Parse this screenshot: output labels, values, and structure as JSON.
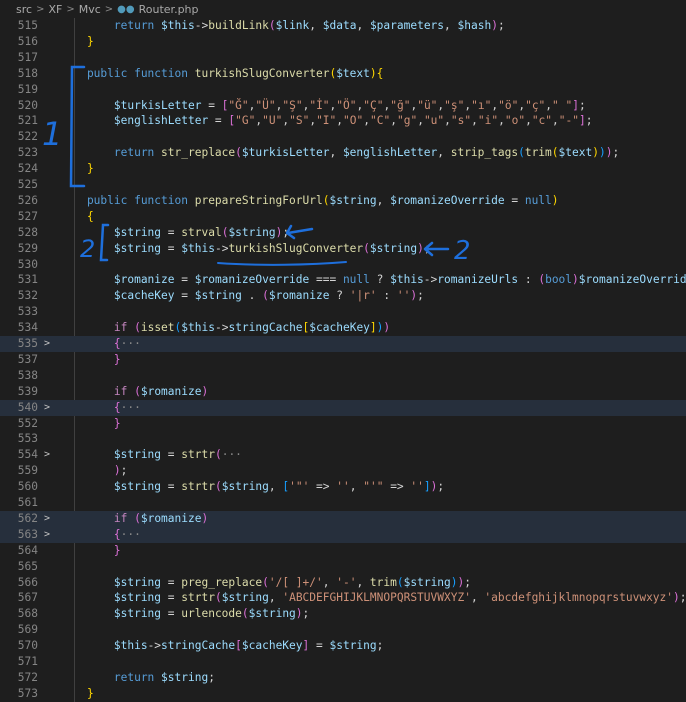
{
  "breadcrumb": {
    "items": [
      "src",
      "XF",
      "Mvc",
      "Router.php"
    ]
  },
  "colors": {
    "background": "#1e1e1e",
    "line_number": "#858585",
    "keyword": "#569cd6",
    "control": "#c586c0",
    "function": "#dcdcaa",
    "variable": "#9cdcfe",
    "string": "#ce9178",
    "annotation_pen": "#1e6fdc",
    "folded_line_highlight": "#262f3c"
  },
  "annotations": {
    "mark_1": "1",
    "mark_2a": "2",
    "mark_2b": "2"
  },
  "lines": [
    {
      "n": "515",
      "tokens": [
        [
          "kw",
          "        return "
        ],
        [
          "var",
          "$this"
        ],
        [
          "pl",
          "->"
        ],
        [
          "fn",
          "buildLink"
        ],
        [
          "br1",
          "("
        ],
        [
          "var",
          "$link"
        ],
        [
          "pl",
          ", "
        ],
        [
          "var",
          "$data"
        ],
        [
          "pl",
          ", "
        ],
        [
          "var",
          "$parameters"
        ],
        [
          "pl",
          ", "
        ],
        [
          "var",
          "$hash"
        ],
        [
          "br1",
          ")"
        ],
        [
          "pl",
          ";"
        ]
      ]
    },
    {
      "n": "516",
      "tokens": [
        [
          "br2",
          "    }"
        ]
      ]
    },
    {
      "n": "517",
      "tokens": []
    },
    {
      "n": "518",
      "tokens": [
        [
          "kw",
          "    public function "
        ],
        [
          "fn",
          "turkishSlugConverter"
        ],
        [
          "br2",
          "("
        ],
        [
          "var",
          "$text"
        ],
        [
          "br2",
          ")"
        ],
        [
          "br2",
          "{"
        ]
      ]
    },
    {
      "n": "519",
      "tokens": []
    },
    {
      "n": "520",
      "tokens": [
        [
          "var",
          "        $turkisLetter"
        ],
        [
          "pl",
          " = "
        ],
        [
          "br1",
          "["
        ],
        [
          "str",
          "\"Ğ\""
        ],
        [
          "pl",
          ","
        ],
        [
          "str",
          "\"Ü\""
        ],
        [
          "pl",
          ","
        ],
        [
          "str",
          "\"Ş\""
        ],
        [
          "pl",
          ","
        ],
        [
          "str",
          "\"İ\""
        ],
        [
          "pl",
          ","
        ],
        [
          "str",
          "\"Ö\""
        ],
        [
          "pl",
          ","
        ],
        [
          "str",
          "\"Ç\""
        ],
        [
          "pl",
          ","
        ],
        [
          "str",
          "\"ğ\""
        ],
        [
          "pl",
          ","
        ],
        [
          "str",
          "\"ü\""
        ],
        [
          "pl",
          ","
        ],
        [
          "str",
          "\"ş\""
        ],
        [
          "pl",
          ","
        ],
        [
          "str",
          "\"ı\""
        ],
        [
          "pl",
          ","
        ],
        [
          "str",
          "\"ö\""
        ],
        [
          "pl",
          ","
        ],
        [
          "str",
          "\"ç\""
        ],
        [
          "pl",
          ","
        ],
        [
          "str",
          "\" \""
        ],
        [
          "br1",
          "]"
        ],
        [
          "pl",
          ";"
        ]
      ]
    },
    {
      "n": "521",
      "tokens": [
        [
          "var",
          "        $englishLetter"
        ],
        [
          "pl",
          " = "
        ],
        [
          "br1",
          "["
        ],
        [
          "str",
          "\"G\""
        ],
        [
          "pl",
          ","
        ],
        [
          "str",
          "\"U\""
        ],
        [
          "pl",
          ","
        ],
        [
          "str",
          "\"S\""
        ],
        [
          "pl",
          ","
        ],
        [
          "str",
          "\"I\""
        ],
        [
          "pl",
          ","
        ],
        [
          "str",
          "\"O\""
        ],
        [
          "pl",
          ","
        ],
        [
          "str",
          "\"C\""
        ],
        [
          "pl",
          ","
        ],
        [
          "str",
          "\"g\""
        ],
        [
          "pl",
          ","
        ],
        [
          "str",
          "\"u\""
        ],
        [
          "pl",
          ","
        ],
        [
          "str",
          "\"s\""
        ],
        [
          "pl",
          ","
        ],
        [
          "str",
          "\"i\""
        ],
        [
          "pl",
          ","
        ],
        [
          "str",
          "\"o\""
        ],
        [
          "pl",
          ","
        ],
        [
          "str",
          "\"c\""
        ],
        [
          "pl",
          ","
        ],
        [
          "str",
          "\"-\""
        ],
        [
          "br1",
          "]"
        ],
        [
          "pl",
          ";"
        ]
      ]
    },
    {
      "n": "522",
      "tokens": []
    },
    {
      "n": "523",
      "tokens": [
        [
          "kw",
          "        return "
        ],
        [
          "fn",
          "str_replace"
        ],
        [
          "br1",
          "("
        ],
        [
          "var",
          "$turkisLetter"
        ],
        [
          "pl",
          ", "
        ],
        [
          "var",
          "$englishLetter"
        ],
        [
          "pl",
          ", "
        ],
        [
          "fn",
          "strip_tags"
        ],
        [
          "br3",
          "("
        ],
        [
          "fn",
          "trim"
        ],
        [
          "br2",
          "("
        ],
        [
          "var",
          "$text"
        ],
        [
          "br2",
          ")"
        ],
        [
          "br3",
          ")"
        ],
        [
          "br1",
          ")"
        ],
        [
          "pl",
          ";"
        ]
      ]
    },
    {
      "n": "524",
      "tokens": [
        [
          "br2",
          "    }"
        ]
      ]
    },
    {
      "n": "525",
      "tokens": []
    },
    {
      "n": "526",
      "tokens": [
        [
          "kw",
          "    public function "
        ],
        [
          "fn",
          "prepareStringForUrl"
        ],
        [
          "br2",
          "("
        ],
        [
          "var",
          "$string"
        ],
        [
          "pl",
          ", "
        ],
        [
          "var",
          "$romanizeOverride"
        ],
        [
          "pl",
          " = "
        ],
        [
          "kw",
          "null"
        ],
        [
          "br2",
          ")"
        ]
      ]
    },
    {
      "n": "527",
      "tokens": [
        [
          "br2",
          "    {"
        ]
      ]
    },
    {
      "n": "528",
      "tokens": [
        [
          "var",
          "        $string"
        ],
        [
          "pl",
          " = "
        ],
        [
          "fn",
          "strval"
        ],
        [
          "br1",
          "("
        ],
        [
          "var",
          "$string"
        ],
        [
          "br1",
          ")"
        ],
        [
          "pl",
          ";"
        ]
      ]
    },
    {
      "n": "529",
      "tokens": [
        [
          "var",
          "        $string"
        ],
        [
          "pl",
          " = "
        ],
        [
          "var",
          "$this"
        ],
        [
          "pl",
          "->"
        ],
        [
          "fn",
          "turkishSlugConverter"
        ],
        [
          "br1",
          "("
        ],
        [
          "var",
          "$string"
        ],
        [
          "br1",
          ")"
        ],
        [
          "pl",
          ";"
        ]
      ]
    },
    {
      "n": "530",
      "tokens": []
    },
    {
      "n": "531",
      "tokens": [
        [
          "var",
          "        $romanize"
        ],
        [
          "pl",
          " = "
        ],
        [
          "var",
          "$romanizeOverride"
        ],
        [
          "pl",
          " === "
        ],
        [
          "kw",
          "null"
        ],
        [
          "pl",
          " ? "
        ],
        [
          "var",
          "$this"
        ],
        [
          "pl",
          "->"
        ],
        [
          "var",
          "romanizeUrls"
        ],
        [
          "pl",
          " : "
        ],
        [
          "br1",
          "("
        ],
        [
          "kw",
          "bool"
        ],
        [
          "br1",
          ")"
        ],
        [
          "var",
          "$romanizeOverride"
        ],
        [
          "pl",
          ";"
        ]
      ]
    },
    {
      "n": "532",
      "tokens": [
        [
          "var",
          "        $cacheKey"
        ],
        [
          "pl",
          " = "
        ],
        [
          "var",
          "$string"
        ],
        [
          "pl",
          " . "
        ],
        [
          "br1",
          "("
        ],
        [
          "var",
          "$romanize"
        ],
        [
          "pl",
          " ? "
        ],
        [
          "str",
          "'|r'"
        ],
        [
          "pl",
          " : "
        ],
        [
          "str",
          "''"
        ],
        [
          "br1",
          ")"
        ],
        [
          "pl",
          ";"
        ]
      ]
    },
    {
      "n": "533",
      "tokens": []
    },
    {
      "n": "534",
      "tokens": [
        [
          "ctl",
          "        if "
        ],
        [
          "br1",
          "("
        ],
        [
          "fn",
          "isset"
        ],
        [
          "br3",
          "("
        ],
        [
          "var",
          "$this"
        ],
        [
          "pl",
          "->"
        ],
        [
          "var",
          "stringCache"
        ],
        [
          "br2",
          "["
        ],
        [
          "var",
          "$cacheKey"
        ],
        [
          "br2",
          "]"
        ],
        [
          "br3",
          ")"
        ],
        [
          "br1",
          ")"
        ]
      ]
    },
    {
      "n": "535",
      "fold": ">",
      "hl": true,
      "tokens": [
        [
          "br1",
          "        {"
        ],
        [
          "ell",
          "···"
        ]
      ]
    },
    {
      "n": "537",
      "tokens": [
        [
          "br1",
          "        }"
        ]
      ]
    },
    {
      "n": "538",
      "tokens": []
    },
    {
      "n": "539",
      "tokens": [
        [
          "ctl",
          "        if "
        ],
        [
          "br1",
          "("
        ],
        [
          "var",
          "$romanize"
        ],
        [
          "br1",
          ")"
        ]
      ]
    },
    {
      "n": "540",
      "fold": ">",
      "hl": true,
      "tokens": [
        [
          "br1",
          "        {"
        ],
        [
          "ell",
          "···"
        ]
      ]
    },
    {
      "n": "552",
      "tokens": [
        [
          "br1",
          "        }"
        ]
      ]
    },
    {
      "n": "553",
      "tokens": []
    },
    {
      "n": "554",
      "fold": ">",
      "tokens": [
        [
          "var",
          "        $string"
        ],
        [
          "pl",
          " = "
        ],
        [
          "fn",
          "strtr"
        ],
        [
          "br1",
          "("
        ],
        [
          "ell",
          "···"
        ]
      ]
    },
    {
      "n": "559",
      "tokens": [
        [
          "br1",
          "        )"
        ],
        [
          "pl",
          ";"
        ]
      ]
    },
    {
      "n": "560",
      "tokens": [
        [
          "var",
          "        $string"
        ],
        [
          "pl",
          " = "
        ],
        [
          "fn",
          "strtr"
        ],
        [
          "br1",
          "("
        ],
        [
          "var",
          "$string"
        ],
        [
          "pl",
          ", "
        ],
        [
          "br3",
          "["
        ],
        [
          "str",
          "'\"'"
        ],
        [
          "pl",
          " => "
        ],
        [
          "str",
          "''"
        ],
        [
          "pl",
          ", "
        ],
        [
          "str",
          "\"'\""
        ],
        [
          "pl",
          " => "
        ],
        [
          "str",
          "''"
        ],
        [
          "br3",
          "]"
        ],
        [
          "br1",
          ")"
        ],
        [
          "pl",
          ";"
        ]
      ]
    },
    {
      "n": "561",
      "tokens": []
    },
    {
      "n": "562",
      "fold": ">",
      "hl": true,
      "tokens": [
        [
          "ctl",
          "        if "
        ],
        [
          "br1",
          "("
        ],
        [
          "var",
          "$romanize"
        ],
        [
          "br1",
          ")"
        ]
      ]
    },
    {
      "n": "563",
      "fold": ">",
      "hl": true,
      "tokens": [
        [
          "br1",
          "        {"
        ],
        [
          "ell",
          "···"
        ]
      ]
    },
    {
      "n": "564",
      "tokens": [
        [
          "br1",
          "        }"
        ]
      ]
    },
    {
      "n": "565",
      "tokens": []
    },
    {
      "n": "566",
      "tokens": [
        [
          "var",
          "        $string"
        ],
        [
          "pl",
          " = "
        ],
        [
          "fn",
          "preg_replace"
        ],
        [
          "br1",
          "("
        ],
        [
          "str",
          "'/[ ]+/'"
        ],
        [
          "pl",
          ", "
        ],
        [
          "str",
          "'-'"
        ],
        [
          "pl",
          ", "
        ],
        [
          "fn",
          "trim"
        ],
        [
          "br3",
          "("
        ],
        [
          "var",
          "$string"
        ],
        [
          "br3",
          ")"
        ],
        [
          "br1",
          ")"
        ],
        [
          "pl",
          ";"
        ]
      ]
    },
    {
      "n": "567",
      "tokens": [
        [
          "var",
          "        $string"
        ],
        [
          "pl",
          " = "
        ],
        [
          "fn",
          "strtr"
        ],
        [
          "br1",
          "("
        ],
        [
          "var",
          "$string"
        ],
        [
          "pl",
          ", "
        ],
        [
          "str",
          "'ABCDEFGHIJKLMNOPQRSTUVWXYZ'"
        ],
        [
          "pl",
          ", "
        ],
        [
          "str",
          "'abcdefghijklmnopqrstuvwxyz'"
        ],
        [
          "br1",
          ")"
        ],
        [
          "pl",
          ";"
        ]
      ]
    },
    {
      "n": "568",
      "tokens": [
        [
          "var",
          "        $string"
        ],
        [
          "pl",
          " = "
        ],
        [
          "fn",
          "urlencode"
        ],
        [
          "br1",
          "("
        ],
        [
          "var",
          "$string"
        ],
        [
          "br1",
          ")"
        ],
        [
          "pl",
          ";"
        ]
      ]
    },
    {
      "n": "569",
      "tokens": []
    },
    {
      "n": "570",
      "tokens": [
        [
          "var",
          "        $this"
        ],
        [
          "pl",
          "->"
        ],
        [
          "var",
          "stringCache"
        ],
        [
          "br1",
          "["
        ],
        [
          "var",
          "$cacheKey"
        ],
        [
          "br1",
          "]"
        ],
        [
          "pl",
          " = "
        ],
        [
          "var",
          "$string"
        ],
        [
          "pl",
          ";"
        ]
      ]
    },
    {
      "n": "571",
      "tokens": []
    },
    {
      "n": "572",
      "tokens": [
        [
          "kw",
          "        return "
        ],
        [
          "var",
          "$string"
        ],
        [
          "pl",
          ";"
        ]
      ]
    },
    {
      "n": "573",
      "tokens": [
        [
          "br2",
          "    }"
        ]
      ]
    }
  ]
}
